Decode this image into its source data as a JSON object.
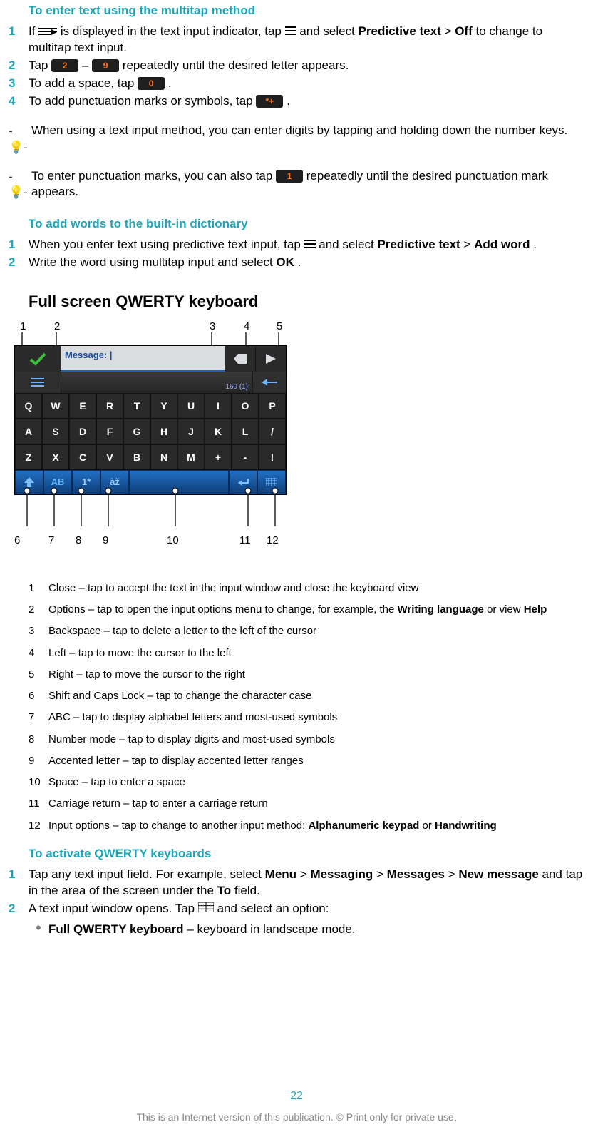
{
  "section1": {
    "title": "To enter text using the multitap method",
    "steps": [
      {
        "n": "1",
        "pre": "If ",
        "mid": " is displayed in the text input indicator, tap ",
        "after": " and select ",
        "bold1": "Predictive text",
        "gt": " > ",
        "bold2": "Off",
        "tail": " to change to multitap text input."
      },
      {
        "n": "2",
        "pre": "Tap ",
        "k1": "2",
        "dash": " – ",
        "k2": "9",
        "tail": " repeatedly until the desired letter appears."
      },
      {
        "n": "3",
        "pre": "To add a space, tap ",
        "k1": "0",
        "tail": "."
      },
      {
        "n": "4",
        "pre": "To add punctuation marks or symbols, tap ",
        "k1": "*+",
        "tail": "."
      }
    ]
  },
  "tips": [
    {
      "text": "When using a text input method, you can enter digits by tapping and holding down the number keys."
    },
    {
      "pre": "To enter punctuation marks, you can also tap ",
      "k": "1",
      "tail": " repeatedly until the desired punctuation mark appears."
    }
  ],
  "section2": {
    "title": "To add words to the built-in dictionary",
    "steps": [
      {
        "n": "1",
        "pre": "When you enter text using predictive text input, tap ",
        "after": " and select ",
        "bold1": "Predictive text",
        "gt": " > ",
        "bold2": "Add word",
        "tail": "."
      },
      {
        "n": "2",
        "text": "Write the word using multitap input and select ",
        "bold": "OK",
        "tail": "."
      }
    ]
  },
  "qwerty_heading": "Full screen QWERTY keyboard",
  "callouts_top": [
    "1",
    "2",
    "3",
    "4",
    "5"
  ],
  "callouts_bottom": [
    "6",
    "7",
    "8",
    "9",
    "10",
    "11",
    "12"
  ],
  "kbd": {
    "msg_label": "Message:",
    "counter": "160 (1)",
    "rows": [
      [
        "Q",
        "W",
        "E",
        "R",
        "T",
        "Y",
        "U",
        "I",
        "O",
        "P"
      ],
      [
        "A",
        "S",
        "D",
        "F",
        "G",
        "H",
        "J",
        "K",
        "L",
        "/"
      ],
      [
        "Z",
        "X",
        "C",
        "V",
        "B",
        "N",
        "M",
        "+",
        "-",
        "!"
      ]
    ],
    "bottom": {
      "abc": "AB",
      "num": "1*",
      "acc": "àž"
    }
  },
  "legend": [
    {
      "n": "1",
      "t": "Close – tap to accept the text in the input window and close the keyboard view"
    },
    {
      "n": "2",
      "t": "Options – tap to open the input options menu to change, for example, the ",
      "b": "Writing language",
      "t2": " or view ",
      "b2": "Help"
    },
    {
      "n": "3",
      "t": "Backspace – tap to delete a letter to the left of the cursor"
    },
    {
      "n": "4",
      "t": "Left – tap to move the cursor to the left"
    },
    {
      "n": "5",
      "t": "Right – tap to move the cursor to the right"
    },
    {
      "n": "6",
      "t": "Shift and Caps Lock – tap to change the character case"
    },
    {
      "n": "7",
      "t": "ABC – tap to display alphabet letters and most-used symbols"
    },
    {
      "n": "8",
      "t": "Number mode – tap to display digits and most-used symbols"
    },
    {
      "n": "9",
      "t": "Accented letter – tap to display accented letter ranges"
    },
    {
      "n": "10",
      "t": "Space – tap to enter a space"
    },
    {
      "n": "11",
      "t": "Carriage return – tap to enter a carriage return"
    },
    {
      "n": "12",
      "t": "Input options – tap to change to another input method: ",
      "b": "Alphanumeric keypad",
      "t2": " or  ",
      "b2": "Handwriting"
    }
  ],
  "section3": {
    "title": "To activate QWERTY keyboards",
    "step1": {
      "n": "1",
      "pre": "Tap any text input field. For example, select ",
      "b1": "Menu",
      "gt1": " > ",
      "b2": "Messaging",
      "gt2": " > ",
      "b3": "Messages",
      "gt3": " > ",
      "b4": "New message",
      "mid": " and tap in the area of the screen under the ",
      "b5": "To",
      "tail": " field."
    },
    "step2": {
      "n": "2",
      "pre": "A text input window opens. Tap ",
      "tail": " and select an option:"
    },
    "bullet": {
      "b": "Full QWERTY keyboard",
      "t": " – keyboard in landscape mode."
    }
  },
  "page_number": "22",
  "footer": "This is an Internet version of this publication. © Print only for private use."
}
